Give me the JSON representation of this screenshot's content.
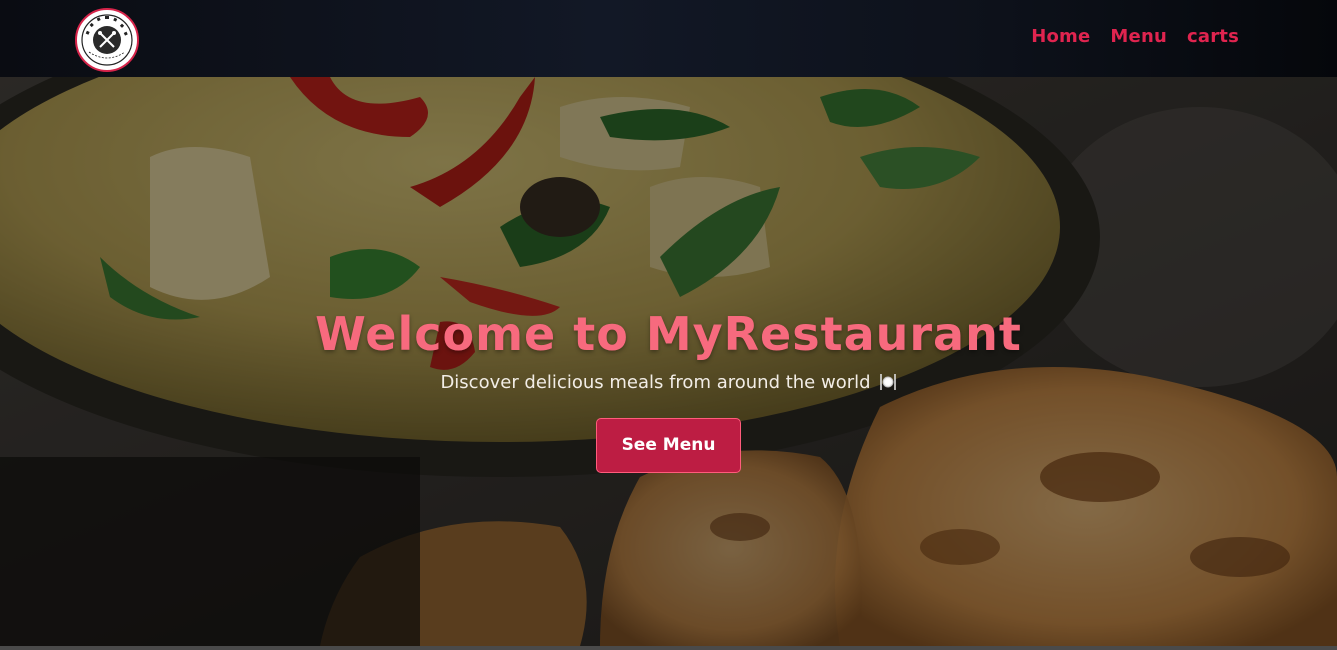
{
  "navbar": {
    "logo": {
      "icon": "restaurant-logo-icon",
      "ring_text": "RESTAURANT"
    },
    "links": [
      {
        "label": "Home"
      },
      {
        "label": "Menu"
      },
      {
        "label": "carts"
      }
    ],
    "link_color": "#e0244f"
  },
  "hero": {
    "title": "Welcome to MyRestaurant",
    "subtitle": "Discover delicious meals from around the world",
    "subtitle_icon": "plate-cutlery-icon",
    "cta_label": "See Menu",
    "title_color": "#f76a7e",
    "cta_color": "#bd1d43"
  }
}
